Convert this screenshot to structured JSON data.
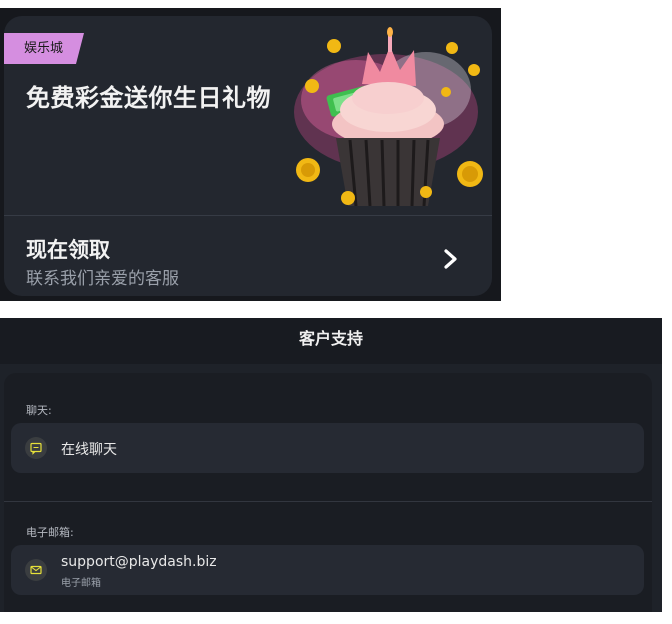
{
  "promo": {
    "badge": "娱乐城",
    "title": "免费彩金送你生日礼物",
    "cta_title": "现在领取",
    "cta_subtitle": "联系我们亲爱的客服",
    "illustration": "birthday-cupcake-coins-icon",
    "chevron_icon": "chevron-right-icon"
  },
  "support": {
    "header_title": "客户支持",
    "chat": {
      "section_label": "聊天:",
      "item_label": "在线聊天",
      "icon": "chat-bubble-icon"
    },
    "email": {
      "section_label": "电子邮箱:",
      "item_label": "support@playdash.biz",
      "item_sublabel": "电子邮箱",
      "icon": "envelope-icon"
    }
  },
  "colors": {
    "page_dark": "#16181d",
    "card_bg": "#23272f",
    "badge_pink": "#d58ee0",
    "icon_yellow": "#e7e13a",
    "text_primary": "#f2f2f2",
    "text_secondary": "#9aa0aa"
  }
}
